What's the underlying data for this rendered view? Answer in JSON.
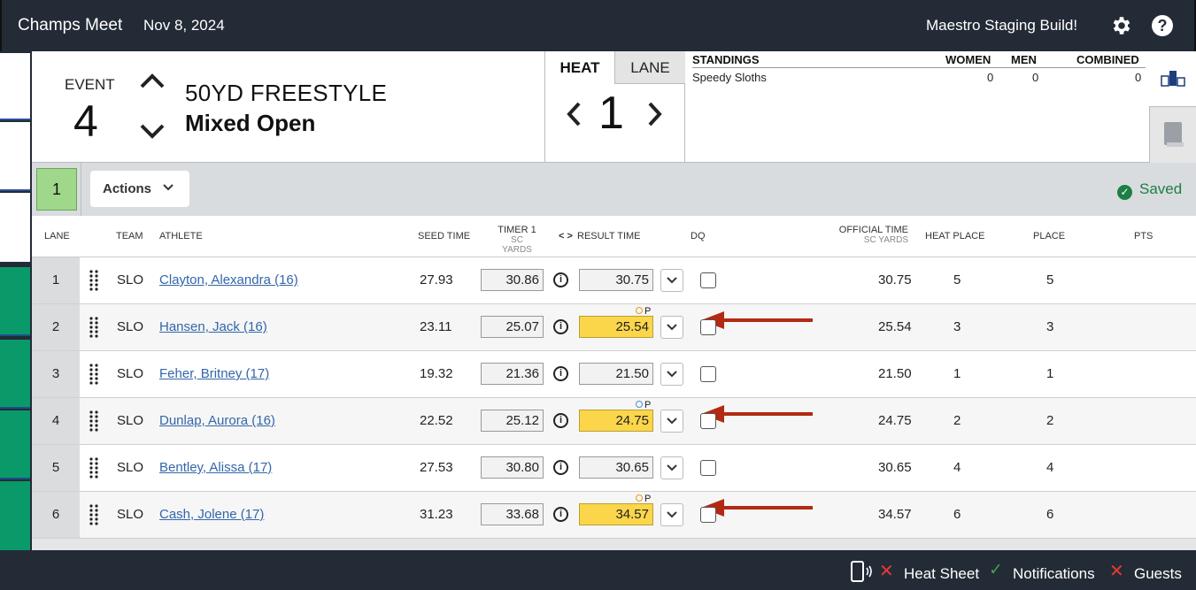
{
  "topbar": {
    "meet_name": "Champs Meet",
    "date": "Nov 8, 2024",
    "build_label": "Maestro Staging Build!",
    "help_glyph": "?"
  },
  "event": {
    "label": "EVENT",
    "number": "4",
    "name": "50YD FREESTYLE",
    "division": "Mixed Open"
  },
  "heat": {
    "heat_tab": "HEAT",
    "lane_tab": "LANE",
    "number": "1"
  },
  "standings": {
    "title": "STANDINGS",
    "columns": [
      "WOMEN",
      "MEN",
      "COMBINED"
    ],
    "rows": [
      {
        "team": "Speedy Sloths",
        "women": "0",
        "men": "0",
        "combined": "0"
      }
    ]
  },
  "toolbar": {
    "heat_chip": "1",
    "actions_label": "Actions",
    "saved_label": "Saved"
  },
  "columns": {
    "lane": "LANE",
    "team": "TEAM",
    "athlete": "ATHLETE",
    "seed": "SEED TIME",
    "timer": "TIMER 1",
    "timer_sub": "SC YARDS",
    "result": "RESULT TIME",
    "result_arrows": "< >",
    "dq": "DQ",
    "official": "OFFICIAL TIME",
    "official_sub": "SC YARDS",
    "heat_place": "HEAT PLACE",
    "place": "PLACE",
    "pts": "PTS"
  },
  "rows": [
    {
      "lane": "1",
      "team": "SLO",
      "athlete": "Clayton, Alexandra (16)",
      "seed": "27.93",
      "timer": "30.86",
      "result": "30.75",
      "flag": "",
      "official": "30.75",
      "heat_place": "5",
      "place": "5"
    },
    {
      "lane": "2",
      "team": "SLO",
      "athlete": "Hansen, Jack (16)",
      "seed": "23.11",
      "timer": "25.07",
      "result": "25.54",
      "flag": "P",
      "official": "25.54",
      "heat_place": "3",
      "place": "3"
    },
    {
      "lane": "3",
      "team": "SLO",
      "athlete": "Feher, Britney (17)",
      "seed": "19.32",
      "timer": "21.36",
      "result": "21.50",
      "flag": "",
      "official": "21.50",
      "heat_place": "1",
      "place": "1"
    },
    {
      "lane": "4",
      "team": "SLO",
      "athlete": "Dunlap, Aurora (16)",
      "seed": "22.52",
      "timer": "25.12",
      "result": "24.75",
      "flag": "P",
      "official": "24.75",
      "heat_place": "2",
      "place": "2"
    },
    {
      "lane": "5",
      "team": "SLO",
      "athlete": "Bentley, Alissa (17)",
      "seed": "27.53",
      "timer": "30.80",
      "result": "30.65",
      "flag": "",
      "official": "30.65",
      "heat_place": "4",
      "place": "4"
    },
    {
      "lane": "6",
      "team": "SLO",
      "athlete": "Cash, Jolene (17)",
      "seed": "31.23",
      "timer": "33.68",
      "result": "34.57",
      "flag": "P",
      "official": "34.57",
      "heat_place": "6",
      "place": "6"
    }
  ],
  "footer": {
    "heat_sheet": "Heat Sheet",
    "notifications": "Notifications",
    "guests": "Guests"
  },
  "colors": {
    "accent_green": "#1c7f45",
    "highlight_yellow": "#fbd64a",
    "annotation_arrow": "#b22a12",
    "topbar_bg": "#232b36"
  }
}
